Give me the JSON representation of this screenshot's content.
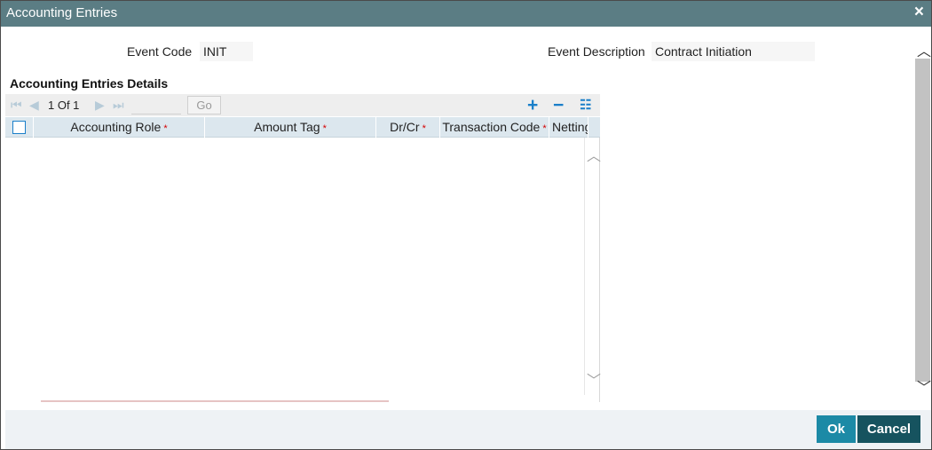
{
  "window": {
    "title": "Accounting Entries",
    "close_icon": "×"
  },
  "event": {
    "code_label": "Event Code",
    "code_value": "INIT",
    "description_label": "Event Description",
    "description_value": "Contract Initiation"
  },
  "section": {
    "title": "Accounting Entries Details"
  },
  "pager": {
    "first_icon": "⏮",
    "prev_icon": "◀",
    "text": "1 Of 1",
    "next_icon": "▶",
    "last_icon": "⏭",
    "go_label": "Go"
  },
  "tools": {
    "add_icon": "+",
    "remove_icon": "−",
    "list_icon": "☷"
  },
  "table": {
    "columns": [
      {
        "label": "Accounting Role",
        "required": "*"
      },
      {
        "label": "Amount Tag",
        "required": "*"
      },
      {
        "label": "Dr/Cr",
        "required": "*"
      },
      {
        "label": "Transaction Code",
        "required": "*"
      },
      {
        "label": "Netting",
        "required": ""
      }
    ],
    "rows": []
  },
  "scroll": {
    "up_icon": "︿",
    "down_icon": "﹀"
  },
  "footer": {
    "ok_label": "Ok",
    "cancel_label": "Cancel"
  },
  "colors": {
    "titlebar": "#5b7d84",
    "accent": "#1a7fc9",
    "ok_button": "#1c8aa6",
    "cancel_button": "#16535f",
    "required": "#d40000"
  }
}
